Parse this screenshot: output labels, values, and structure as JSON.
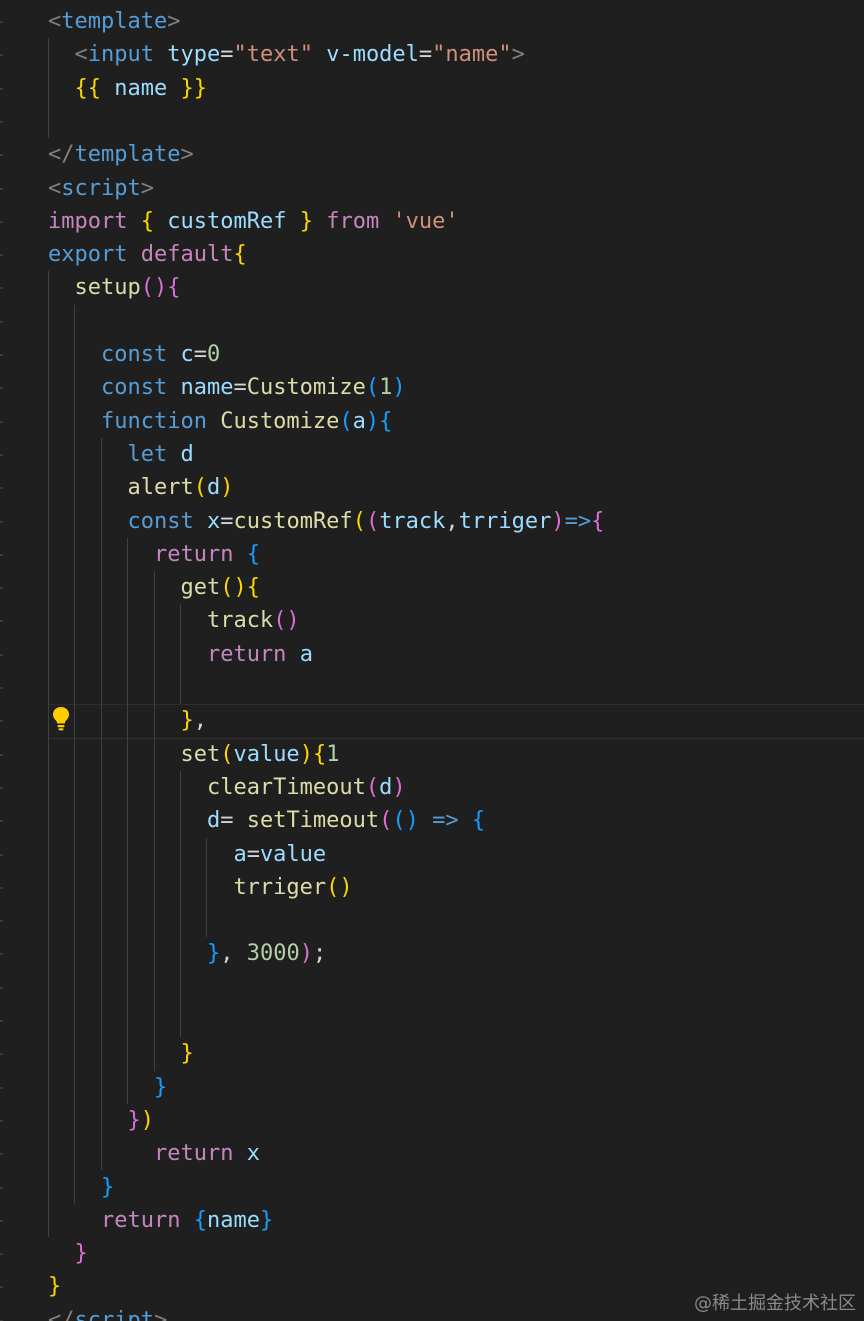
{
  "colors": {
    "background": "#1f1f1f",
    "default": "#d4d4d4",
    "tag": "#808080",
    "tagname": "#569cd6",
    "attr": "#9cdcfe",
    "string": "#ce9178",
    "keyword_blue": "#569cd6",
    "keyword_purple": "#c586c0",
    "variable": "#9cdcfe",
    "function": "#dcdcaa",
    "number": "#b5cea8",
    "bracket_gold": "#ffd700",
    "bracket_pink": "#da70d6",
    "bracket_blue": "#179fff",
    "lightbulb": "#ffcc00"
  },
  "icons": {
    "lightbulb": "lightbulb-icon"
  },
  "code": {
    "lines": [
      [
        {
          "t": "<",
          "c": "tag"
        },
        {
          "t": "template",
          "c": "tagname"
        },
        {
          "t": ">",
          "c": "tag"
        }
      ],
      [
        {
          "t": "  "
        },
        {
          "t": "<",
          "c": "tag"
        },
        {
          "t": "input",
          "c": "tagname"
        },
        {
          "t": " "
        },
        {
          "t": "type",
          "c": "attr"
        },
        {
          "t": "=",
          "c": "default"
        },
        {
          "t": "\"text\"",
          "c": "string"
        },
        {
          "t": " "
        },
        {
          "t": "v-model",
          "c": "attr"
        },
        {
          "t": "=",
          "c": "default"
        },
        {
          "t": "\"name\"",
          "c": "string"
        },
        {
          "t": ">",
          "c": "tag"
        }
      ],
      [
        {
          "t": "  "
        },
        {
          "t": "{{",
          "c": "bracket_gold"
        },
        {
          "t": " "
        },
        {
          "t": "name",
          "c": "variable"
        },
        {
          "t": " "
        },
        {
          "t": "}}",
          "c": "bracket_gold"
        }
      ],
      [
        {
          "t": ""
        }
      ],
      [
        {
          "t": "</",
          "c": "tag"
        },
        {
          "t": "template",
          "c": "tagname"
        },
        {
          "t": ">",
          "c": "tag"
        }
      ],
      [
        {
          "t": "<",
          "c": "tag"
        },
        {
          "t": "script",
          "c": "tagname"
        },
        {
          "t": ">",
          "c": "tag"
        }
      ],
      [
        {
          "t": "import",
          "c": "keyword_purple"
        },
        {
          "t": " "
        },
        {
          "t": "{",
          "c": "bracket_gold"
        },
        {
          "t": " "
        },
        {
          "t": "customRef",
          "c": "variable"
        },
        {
          "t": " "
        },
        {
          "t": "}",
          "c": "bracket_gold"
        },
        {
          "t": " "
        },
        {
          "t": "from",
          "c": "keyword_purple"
        },
        {
          "t": " "
        },
        {
          "t": "'vue'",
          "c": "string"
        }
      ],
      [
        {
          "t": "export",
          "c": "keyword_blue"
        },
        {
          "t": " "
        },
        {
          "t": "default",
          "c": "keyword_purple"
        },
        {
          "t": "{",
          "c": "bracket_gold"
        }
      ],
      [
        {
          "t": "  "
        },
        {
          "t": "setup",
          "c": "function"
        },
        {
          "t": "()",
          "c": "bracket_pink"
        },
        {
          "t": "{",
          "c": "bracket_pink"
        }
      ],
      [
        {
          "t": ""
        }
      ],
      [
        {
          "t": "    "
        },
        {
          "t": "const",
          "c": "keyword_blue"
        },
        {
          "t": " "
        },
        {
          "t": "c",
          "c": "variable"
        },
        {
          "t": "=",
          "c": "default"
        },
        {
          "t": "0",
          "c": "number"
        }
      ],
      [
        {
          "t": "    "
        },
        {
          "t": "const",
          "c": "keyword_blue"
        },
        {
          "t": " "
        },
        {
          "t": "name",
          "c": "variable"
        },
        {
          "t": "=",
          "c": "default"
        },
        {
          "t": "Customize",
          "c": "function"
        },
        {
          "t": "(",
          "c": "bracket_blue"
        },
        {
          "t": "1",
          "c": "number"
        },
        {
          "t": ")",
          "c": "bracket_blue"
        }
      ],
      [
        {
          "t": "    "
        },
        {
          "t": "function",
          "c": "keyword_blue"
        },
        {
          "t": " "
        },
        {
          "t": "Customize",
          "c": "function"
        },
        {
          "t": "(",
          "c": "bracket_blue"
        },
        {
          "t": "a",
          "c": "variable"
        },
        {
          "t": ")",
          "c": "bracket_blue"
        },
        {
          "t": "{",
          "c": "bracket_blue"
        }
      ],
      [
        {
          "t": "      "
        },
        {
          "t": "let",
          "c": "keyword_blue"
        },
        {
          "t": " "
        },
        {
          "t": "d",
          "c": "variable"
        }
      ],
      [
        {
          "t": "      "
        },
        {
          "t": "alert",
          "c": "function"
        },
        {
          "t": "(",
          "c": "bracket_gold"
        },
        {
          "t": "d",
          "c": "variable"
        },
        {
          "t": ")",
          "c": "bracket_gold"
        }
      ],
      [
        {
          "t": "      "
        },
        {
          "t": "const",
          "c": "keyword_blue"
        },
        {
          "t": " "
        },
        {
          "t": "x",
          "c": "variable"
        },
        {
          "t": "=",
          "c": "default"
        },
        {
          "t": "customRef",
          "c": "function"
        },
        {
          "t": "(",
          "c": "bracket_gold"
        },
        {
          "t": "(",
          "c": "bracket_pink"
        },
        {
          "t": "track",
          "c": "variable"
        },
        {
          "t": ",",
          "c": "default"
        },
        {
          "t": "trriger",
          "c": "variable"
        },
        {
          "t": ")",
          "c": "bracket_pink"
        },
        {
          "t": "=>",
          "c": "keyword_blue"
        },
        {
          "t": "{",
          "c": "bracket_pink"
        }
      ],
      [
        {
          "t": "        "
        },
        {
          "t": "return",
          "c": "keyword_purple"
        },
        {
          "t": " "
        },
        {
          "t": "{",
          "c": "bracket_blue"
        }
      ],
      [
        {
          "t": "          "
        },
        {
          "t": "get",
          "c": "function"
        },
        {
          "t": "()",
          "c": "bracket_gold"
        },
        {
          "t": "{",
          "c": "bracket_gold"
        }
      ],
      [
        {
          "t": "            "
        },
        {
          "t": "track",
          "c": "function"
        },
        {
          "t": "()",
          "c": "bracket_pink"
        }
      ],
      [
        {
          "t": "            "
        },
        {
          "t": "return",
          "c": "keyword_purple"
        },
        {
          "t": " "
        },
        {
          "t": "a",
          "c": "variable"
        }
      ],
      [
        {
          "t": ""
        }
      ],
      [
        {
          "t": "          "
        },
        {
          "t": "}",
          "c": "bracket_gold"
        },
        {
          "t": ",",
          "c": "default"
        }
      ],
      [
        {
          "t": "          "
        },
        {
          "t": "set",
          "c": "function"
        },
        {
          "t": "(",
          "c": "bracket_gold"
        },
        {
          "t": "value",
          "c": "variable"
        },
        {
          "t": ")",
          "c": "bracket_gold"
        },
        {
          "t": "{",
          "c": "bracket_gold"
        },
        {
          "t": "1",
          "c": "number"
        }
      ],
      [
        {
          "t": "            "
        },
        {
          "t": "clearTimeout",
          "c": "function"
        },
        {
          "t": "(",
          "c": "bracket_pink"
        },
        {
          "t": "d",
          "c": "variable"
        },
        {
          "t": ")",
          "c": "bracket_pink"
        }
      ],
      [
        {
          "t": "            "
        },
        {
          "t": "d",
          "c": "variable"
        },
        {
          "t": "= ",
          "c": "default"
        },
        {
          "t": "setTimeout",
          "c": "function"
        },
        {
          "t": "(",
          "c": "bracket_pink"
        },
        {
          "t": "()",
          "c": "bracket_blue"
        },
        {
          "t": " "
        },
        {
          "t": "=>",
          "c": "keyword_blue"
        },
        {
          "t": " "
        },
        {
          "t": "{",
          "c": "bracket_blue"
        }
      ],
      [
        {
          "t": "              "
        },
        {
          "t": "a",
          "c": "variable"
        },
        {
          "t": "=",
          "c": "default"
        },
        {
          "t": "value",
          "c": "variable"
        }
      ],
      [
        {
          "t": "              "
        },
        {
          "t": "trriger",
          "c": "function"
        },
        {
          "t": "()",
          "c": "bracket_gold"
        }
      ],
      [
        {
          "t": ""
        }
      ],
      [
        {
          "t": "            "
        },
        {
          "t": "}",
          "c": "bracket_blue"
        },
        {
          "t": ", ",
          "c": "default"
        },
        {
          "t": "3000",
          "c": "number"
        },
        {
          "t": ")",
          "c": "bracket_pink"
        },
        {
          "t": ";",
          "c": "default"
        }
      ],
      [
        {
          "t": ""
        }
      ],
      [
        {
          "t": ""
        }
      ],
      [
        {
          "t": "          "
        },
        {
          "t": "}",
          "c": "bracket_gold"
        }
      ],
      [
        {
          "t": "        "
        },
        {
          "t": "}",
          "c": "bracket_blue"
        }
      ],
      [
        {
          "t": "      "
        },
        {
          "t": "}",
          "c": "bracket_pink"
        },
        {
          "t": ")",
          "c": "bracket_gold"
        }
      ],
      [
        {
          "t": "        "
        },
        {
          "t": "return",
          "c": "keyword_purple"
        },
        {
          "t": " "
        },
        {
          "t": "x",
          "c": "variable"
        }
      ],
      [
        {
          "t": "    "
        },
        {
          "t": "}",
          "c": "bracket_blue"
        }
      ],
      [
        {
          "t": "    "
        },
        {
          "t": "return",
          "c": "keyword_purple"
        },
        {
          "t": " "
        },
        {
          "t": "{",
          "c": "bracket_blue"
        },
        {
          "t": "name",
          "c": "variable"
        },
        {
          "t": "}",
          "c": "bracket_blue"
        }
      ],
      [
        {
          "t": "  "
        },
        {
          "t": "}",
          "c": "bracket_pink"
        }
      ],
      [
        {
          "t": "}",
          "c": "bracket_gold"
        }
      ],
      [
        {
          "t": "</",
          "c": "tag"
        },
        {
          "t": "script",
          "c": "tagname"
        },
        {
          "t": ">",
          "c": "tag"
        }
      ]
    ]
  },
  "watermark": "@稀土掘金技术社区"
}
